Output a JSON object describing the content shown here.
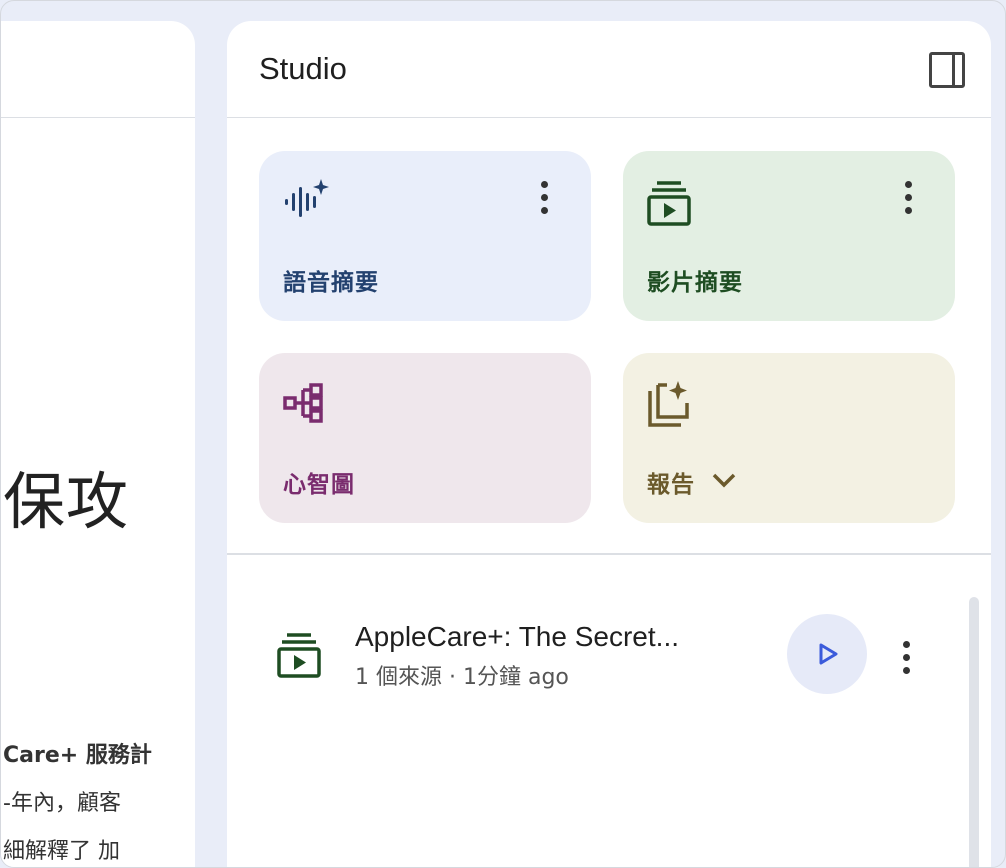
{
  "left_panel": {
    "heading": "保攻",
    "lines": [
      "Care+ 服務計",
      "-年內，顧客",
      "細解釋了 加"
    ]
  },
  "studio": {
    "title": "Studio",
    "cards": [
      {
        "label": "語音摘要",
        "icon": "audio-sparkle-icon",
        "color": "#23416f"
      },
      {
        "label": "影片摘要",
        "icon": "video-stack-icon",
        "color": "#1e4d22"
      },
      {
        "label": "心智圖",
        "icon": "mind-map-icon",
        "color": "#7a2c6e"
      },
      {
        "label": "報告",
        "icon": "report-sparkle-icon",
        "color": "#6b5a2c"
      }
    ],
    "item": {
      "title": "AppleCare+: The Secret...",
      "meta": "1 個來源 · 1分鐘 ago",
      "icon": "video-stack-icon"
    }
  }
}
